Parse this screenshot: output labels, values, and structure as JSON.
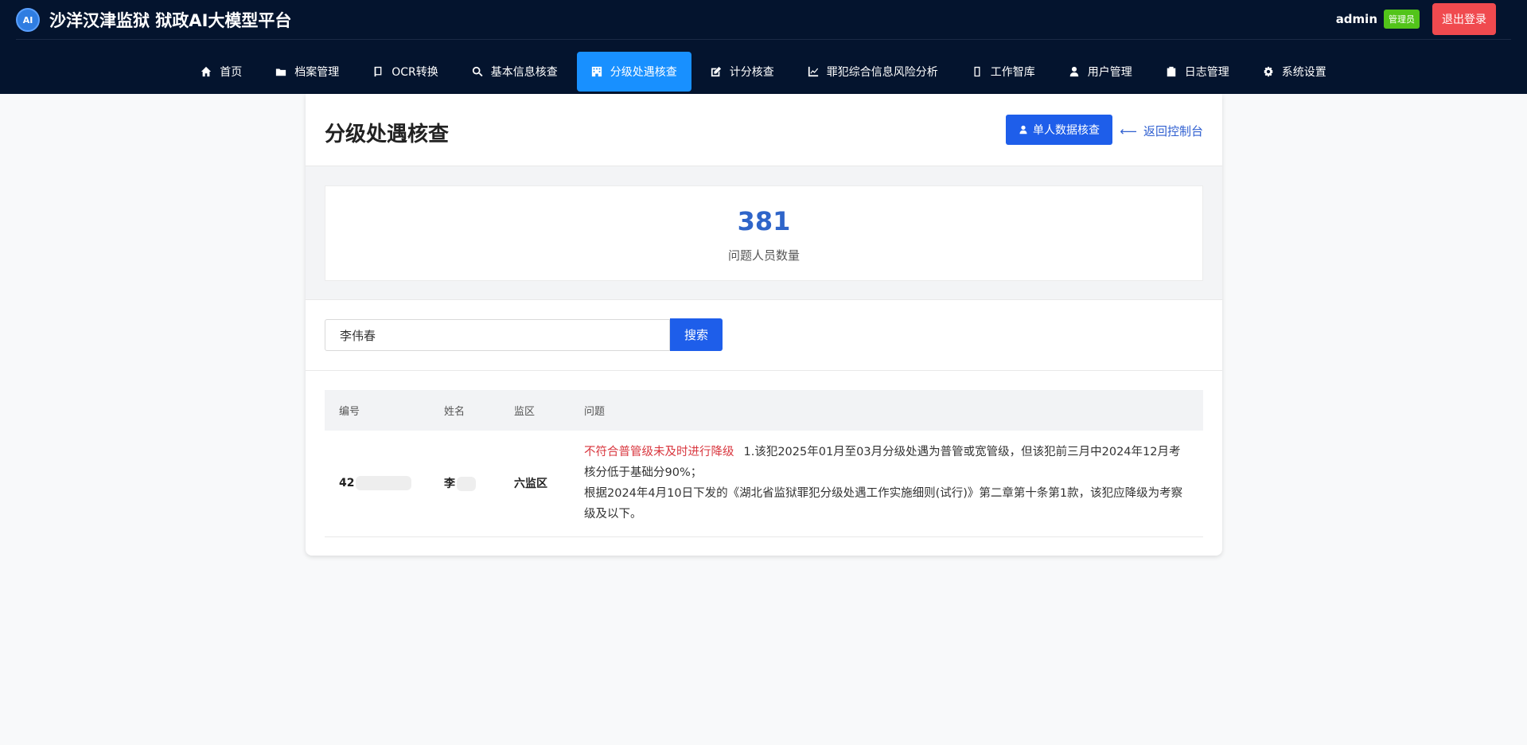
{
  "header": {
    "logo_text": "AI",
    "title": "沙洋汉津监狱 狱政AI大模型平台",
    "username": "admin",
    "role": "管理员",
    "logout_label": "退出登录"
  },
  "nav": [
    {
      "label": "首页",
      "icon": "home-icon"
    },
    {
      "label": "档案管理",
      "icon": "folder-icon"
    },
    {
      "label": "OCR转换",
      "icon": "book-icon"
    },
    {
      "label": "基本信息核查",
      "icon": "search-icon"
    },
    {
      "label": "分级处遇核查",
      "icon": "building-icon",
      "active": true
    },
    {
      "label": "计分核查",
      "icon": "edit-icon"
    },
    {
      "label": "罪犯综合信息风险分析",
      "icon": "chart-icon"
    },
    {
      "label": "工作智库",
      "icon": "mobile-icon"
    },
    {
      "label": "用户管理",
      "icon": "user-icon"
    },
    {
      "label": "日志管理",
      "icon": "clipboard-icon"
    },
    {
      "label": "系统设置",
      "icon": "gear-icon"
    }
  ],
  "page": {
    "title": "分级处遇核查",
    "single_check_label": "单人数据核查",
    "back_arrow": "⟵",
    "back_label": "返回控制台"
  },
  "stats": {
    "value": "381",
    "label": "问题人员数量"
  },
  "search": {
    "value": "李伟春",
    "button_label": "搜索"
  },
  "table": {
    "headers": [
      "编号",
      "姓名",
      "监区",
      "问题"
    ],
    "rows": [
      {
        "id": "42",
        "name": "李",
        "area": "六监区",
        "issue_tag": "不符合普管级未及时进行降级",
        "issue_line1": "1.该犯2025年01月至03月分级处遇为普管或宽管级，但该犯前三月中2024年12月考核分低于基础分90%；",
        "issue_line2": "根据2024年4月10日下发的《湖北省监狱罪犯分级处遇工作实施细则(试行)》第二章第十条第1款，该犯应降级为考察级及以下。"
      }
    ]
  },
  "colors": {
    "topbar": "#04142e",
    "active_nav": "#1890ff",
    "primary_button": "#1e5eea",
    "logout": "#f04a4f",
    "badge": "#52c41a",
    "issue_tag": "#d9363e",
    "stat_value": "#2f65c9"
  }
}
